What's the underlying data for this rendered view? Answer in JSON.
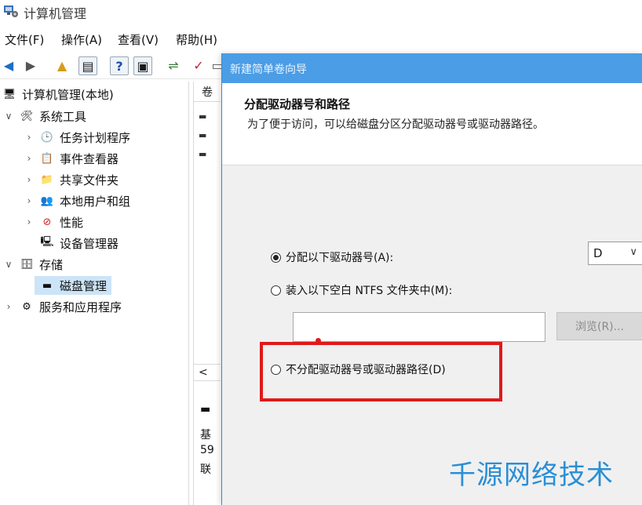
{
  "window": {
    "title": "计算机管理"
  },
  "menu": [
    "文件(F)",
    "操作(A)",
    "查看(V)",
    "帮助(H)"
  ],
  "toolbar_icons": [
    "back-arrow-icon",
    "forward-arrow-icon",
    "up-folder-icon",
    "console-tree-icon",
    "help-icon",
    "properties-icon",
    "connect-icon",
    "check-icon",
    "disk-icon"
  ],
  "tree": {
    "root": "计算机管理(本地)",
    "system_tools": "系统工具",
    "task_scheduler": "任务计划程序",
    "event_viewer": "事件查看器",
    "shared_folders": "共享文件夹",
    "local_users": "本地用户和组",
    "performance": "性能",
    "device_manager": "设备管理器",
    "storage": "存储",
    "disk_management": "磁盘管理",
    "services_apps": "服务和应用程序"
  },
  "middle": {
    "header": "卷",
    "scroll_left": "<",
    "lower_label_1": "基",
    "lower_label_2": "59",
    "lower_label_3": "联"
  },
  "dialog": {
    "title": "新建简单卷向导",
    "heading": "分配驱动器号和路径",
    "subheading": "为了便于访问，可以给磁盘分区分配驱动器号或驱动器路径。",
    "option_assign": "分配以下驱动器号(A):",
    "option_mount": "装入以下空白 NTFS 文件夹中(M):",
    "option_none": "不分配驱动器号或驱动器路径(D)",
    "drive_letter": "D",
    "browse_label": "浏览(R)...",
    "selected_option": "assign"
  },
  "watermark": "千源网络技术",
  "colors": {
    "accent": "#4b9de5",
    "highlight": "#e01919",
    "watermark": "#2a8fd6"
  }
}
